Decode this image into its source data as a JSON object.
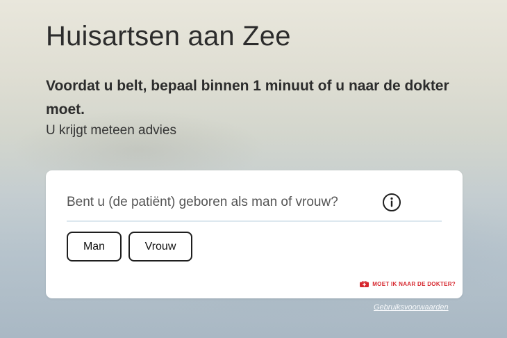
{
  "header": {
    "title": "Huisartsen aan Zee",
    "lead": "Voordat u belt, bepaal binnen 1 minuut of u naar de dokter moet.",
    "subtitle": "U krijgt meteen advies"
  },
  "card": {
    "question": "Bent u (de patiënt) geboren als man of vrouw?",
    "info_icon": "info-circle-icon",
    "answers": [
      {
        "label": "Man"
      },
      {
        "label": "Vrouw"
      }
    ],
    "brand": {
      "icon": "first-aid-kit-icon",
      "label": "MOET IK NAAR DE DOKTER?",
      "color": "#d6262d"
    }
  },
  "footer": {
    "terms_link": "Gebruiksvoorwaarden"
  }
}
